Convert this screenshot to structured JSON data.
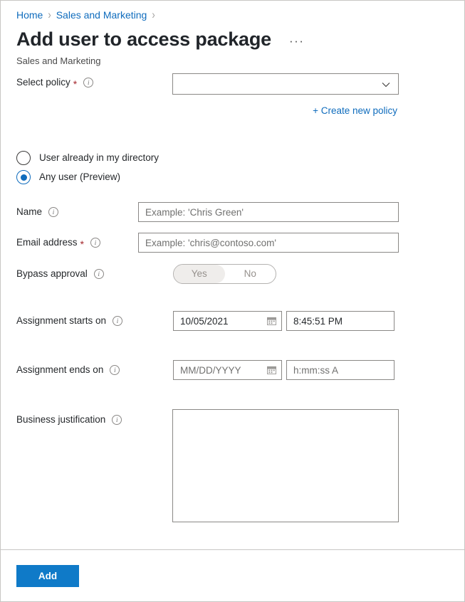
{
  "breadcrumb": {
    "items": [
      {
        "label": "Home"
      },
      {
        "label": "Sales and Marketing"
      }
    ],
    "separator": "›"
  },
  "header": {
    "title": "Add user to access package",
    "more_label": "···",
    "subtitle": "Sales and Marketing"
  },
  "form": {
    "select_policy": {
      "label": "Select policy",
      "required_marker": "*",
      "info_icon": "info-icon",
      "value": "",
      "chevron_icon": "chevron-down-icon"
    },
    "create_policy_link": "+ Create new policy",
    "user_type": {
      "options": [
        {
          "label": "User already in my directory",
          "selected": false
        },
        {
          "label": "Any user (Preview)",
          "selected": true
        }
      ]
    },
    "name": {
      "label": "Name",
      "info_icon": "info-icon",
      "value": "",
      "placeholder": "Example: 'Chris Green'"
    },
    "email": {
      "label": "Email address",
      "required_marker": "*",
      "info_icon": "info-icon",
      "value": "",
      "placeholder": "Example: 'chris@contoso.com'"
    },
    "bypass_approval": {
      "label": "Bypass approval",
      "info_icon": "info-icon",
      "yes_label": "Yes",
      "no_label": "No",
      "selected": "Yes"
    },
    "assignment_starts": {
      "label": "Assignment starts on",
      "info_icon": "info-icon",
      "date_value": "10/05/2021",
      "date_placeholder": "MM/DD/YYYY",
      "time_value": "8:45:51 PM",
      "time_placeholder": "h:mm:ss A",
      "calendar_icon": "calendar-icon"
    },
    "assignment_ends": {
      "label": "Assignment ends on",
      "info_icon": "info-icon",
      "date_value": "",
      "date_placeholder": "MM/DD/YYYY",
      "time_value": "",
      "time_placeholder": "h:mm:ss A",
      "calendar_icon": "calendar-icon"
    },
    "business_justification": {
      "label": "Business justification",
      "info_icon": "info-icon",
      "value": "",
      "placeholder": ""
    }
  },
  "footer": {
    "add_label": "Add"
  },
  "colors": {
    "link": "#0f6cbd",
    "accent": "#0f7ac8",
    "required": "#a4262c",
    "border": "#8a8886",
    "frame": "#c8c6c4",
    "text": "#25282b"
  }
}
